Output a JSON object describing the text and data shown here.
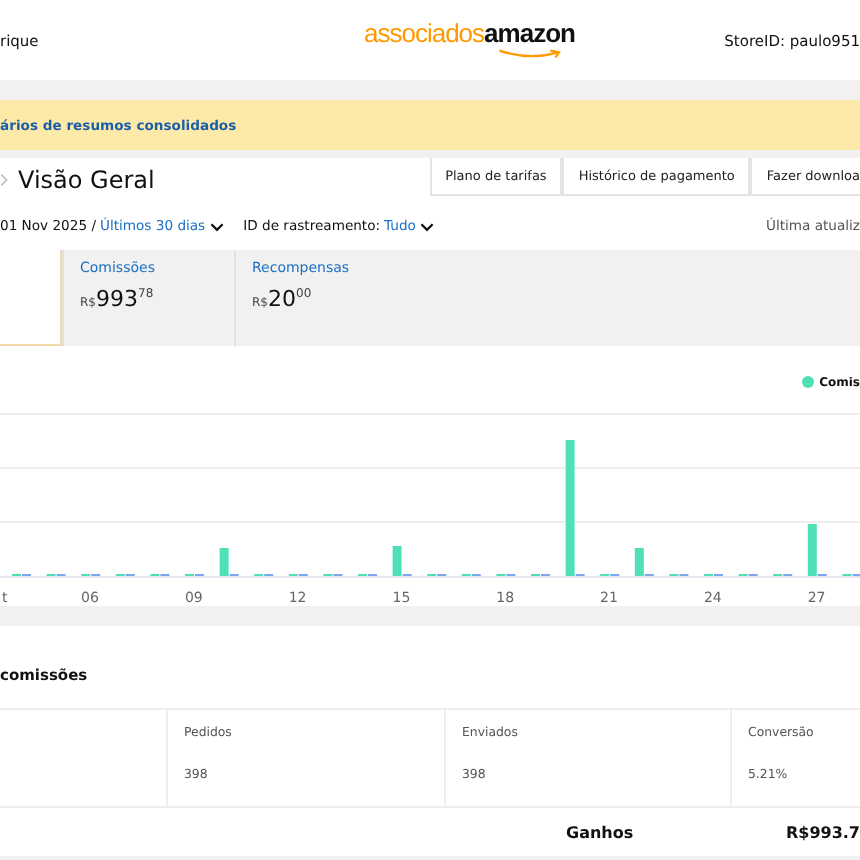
{
  "header": {
    "user_name": "rique",
    "logo": {
      "part_1": "associados",
      "part_2": "amazon"
    },
    "store_id": "StoreID: paulo951"
  },
  "banner": {
    "text": "ários de resumos consolidados"
  },
  "page_title": "Visão Geral",
  "tabs": [
    {
      "label": "Plano de tarifas"
    },
    {
      "label": "Histórico de pagamento"
    },
    {
      "label": "Fazer downloa"
    }
  ],
  "filters": {
    "date": "01 Nov 2025 /",
    "range": "Últimos 30 dias",
    "tracking_label": "ID de rastreamento:",
    "tracking_value": "Tudo",
    "last_update": "Última atualiz"
  },
  "cards": [
    {
      "selected": true
    },
    {
      "label": "Comissões",
      "currency": "R$",
      "whole": "993",
      "cents": "78",
      "selected": false
    },
    {
      "label": "Recompensas",
      "currency": "R$",
      "whole": "20",
      "cents": "00",
      "selected": false
    }
  ],
  "chart": {
    "legend": "Comis",
    "x_labels": [
      "t",
      "06",
      "09",
      "12",
      "15",
      "18",
      "21",
      "24",
      "27"
    ]
  },
  "commissions": {
    "title": "comissões",
    "columns": [
      {
        "label": "Pedidos",
        "value": "398"
      },
      {
        "label": "Enviados",
        "value": "398"
      },
      {
        "label": "Conversão",
        "value": "5.21%"
      }
    ],
    "earnings_label": "Ganhos",
    "earnings_value": "R$993.7"
  }
}
